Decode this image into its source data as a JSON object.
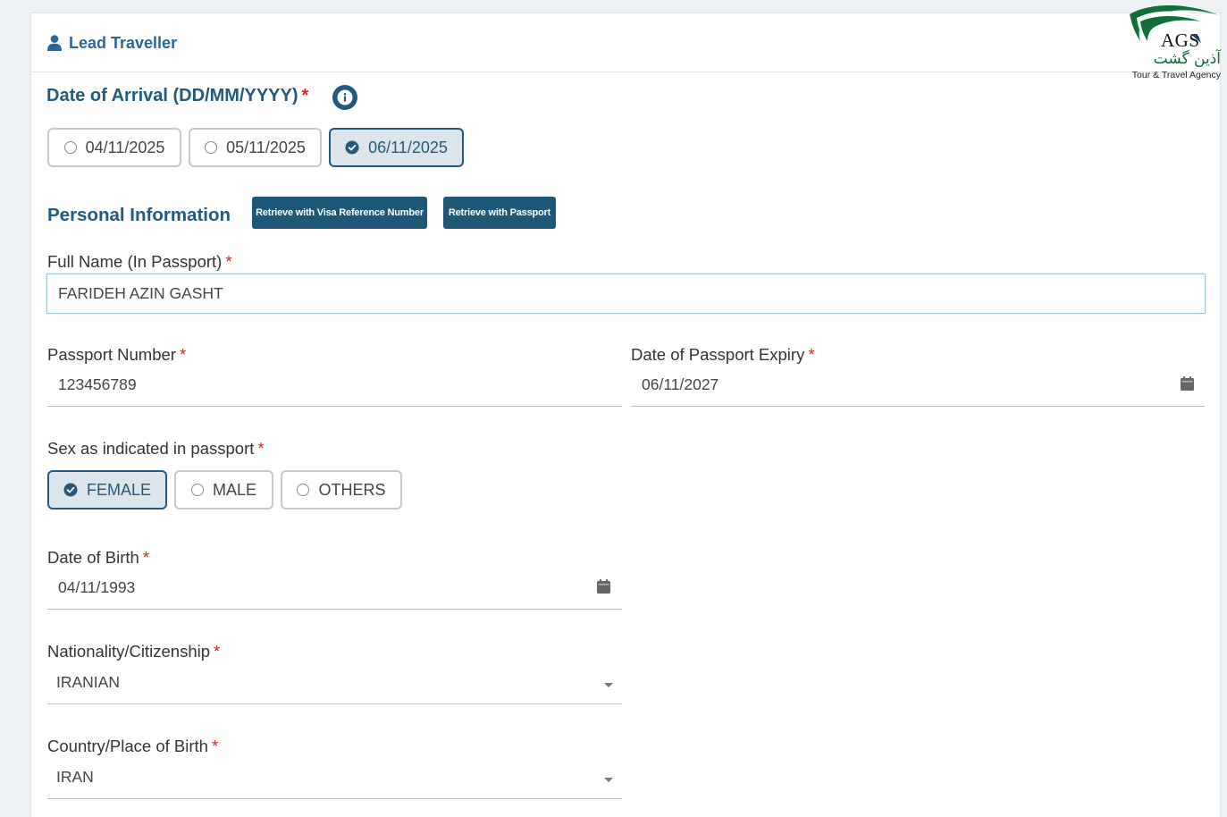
{
  "header": {
    "title": "Lead Traveller"
  },
  "logo": {
    "brand": "AGS",
    "persian": "آذین گشت",
    "tagline": "Tour & Travel Agency"
  },
  "arrival": {
    "label": "Date of Arrival (DD/MM/YYYY)",
    "required": "*",
    "options": [
      "04/11/2025",
      "05/11/2025",
      "06/11/2025"
    ],
    "selected": "06/11/2025"
  },
  "personal": {
    "title": "Personal Information",
    "retrieve_visa_label": "Retrieve with Visa Reference Number",
    "retrieve_passport_label": "Retrieve with Passport"
  },
  "full_name": {
    "label": "Full Name (In Passport)",
    "required": "*",
    "value": "FARIDEH AZIN GASHT"
  },
  "passport_number": {
    "label": "Passport Number",
    "required": "*",
    "value": "123456789"
  },
  "passport_expiry": {
    "label": "Date of Passport Expiry",
    "required": "*",
    "value": "06/11/2027"
  },
  "sex": {
    "label": "Sex as indicated in passport",
    "required": "*",
    "options": [
      "FEMALE",
      "MALE",
      "OTHERS"
    ],
    "selected": "FEMALE"
  },
  "dob": {
    "label": "Date of Birth",
    "required": "*",
    "value": "04/11/1993"
  },
  "nationality": {
    "label": "Nationality/Citizenship",
    "required": "*",
    "value": "IRANIAN"
  },
  "birth_country": {
    "label": "Country/Place of Birth",
    "required": "*",
    "value": "IRAN"
  },
  "colors": {
    "accent": "#1e5675",
    "heading": "#215a7c",
    "required": "#d62828",
    "selected_bg": "#dde5ec"
  },
  "icons": [
    "user-icon",
    "info-icon",
    "check-circle-icon",
    "calendar-icon",
    "chevron-down-icon"
  ]
}
